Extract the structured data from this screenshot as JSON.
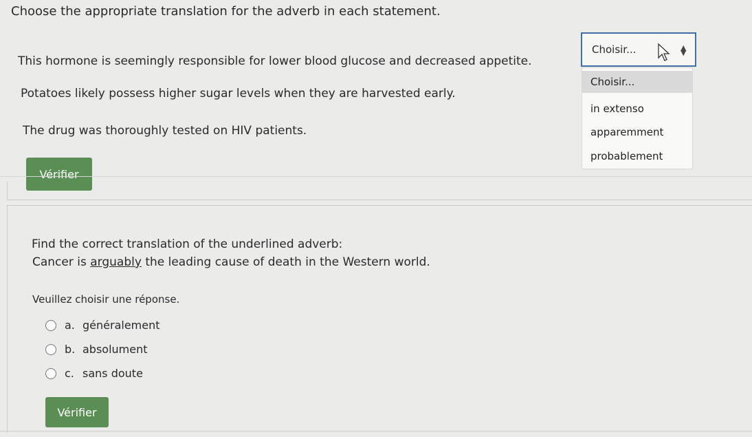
{
  "question1": {
    "instruction": "Choose the appropriate translation for the adverb in each statement.",
    "statements": [
      "This hormone is seemingly responsible for lower blood glucose and decreased appetite.",
      "Potatoes likely possess higher sugar levels when they are harvested early.",
      "The drug was thoroughly tested on HIV patients."
    ],
    "select": {
      "value": "Choisir...",
      "options": [
        "Choisir...",
        "in extenso",
        "apparemment",
        "probablement"
      ]
    },
    "check_button": "Vérifier"
  },
  "question2": {
    "prompt": "Find the correct translation of the underlined adverb:",
    "sentence_before": "Cancer is ",
    "sentence_underlined": "arguably",
    "sentence_after": " the leading cause of death in the Western world.",
    "choose_label": "Veuillez choisir une réponse.",
    "options": [
      {
        "letter": "a.",
        "text": "généralement"
      },
      {
        "letter": "b.",
        "text": "absolument"
      },
      {
        "letter": "c.",
        "text": "sans doute"
      }
    ],
    "check_button": "Vérifier"
  },
  "colors": {
    "button": "#5a8e54",
    "select_border": "#3f6fa7",
    "background": "#ebebea"
  }
}
